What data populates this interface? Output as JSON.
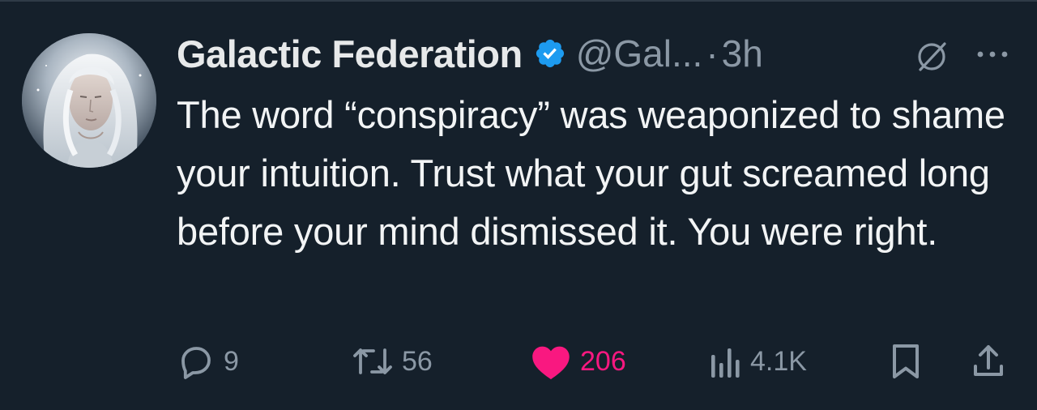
{
  "tweet": {
    "author": {
      "display_name": "Galactic Federation",
      "handle": "@Gal...",
      "verified": true,
      "verified_color": "#1d9bf0"
    },
    "separator": "·",
    "time": "3h",
    "text": "The word “conspiracy” was weaponized to shame your intuition. Trust what your gut screamed long before your mind dismissed it. You were right.",
    "icons": {
      "grok": "grok-icon",
      "more": "more-icon"
    },
    "actions": {
      "replies": "9",
      "reposts": "56",
      "likes": "206",
      "views": "4.1K",
      "liked": true,
      "like_color": "#f91880"
    }
  },
  "theme": {
    "background": "#15202b",
    "secondary_text": "#8b98a5",
    "primary_text": "#e7e9ea"
  }
}
